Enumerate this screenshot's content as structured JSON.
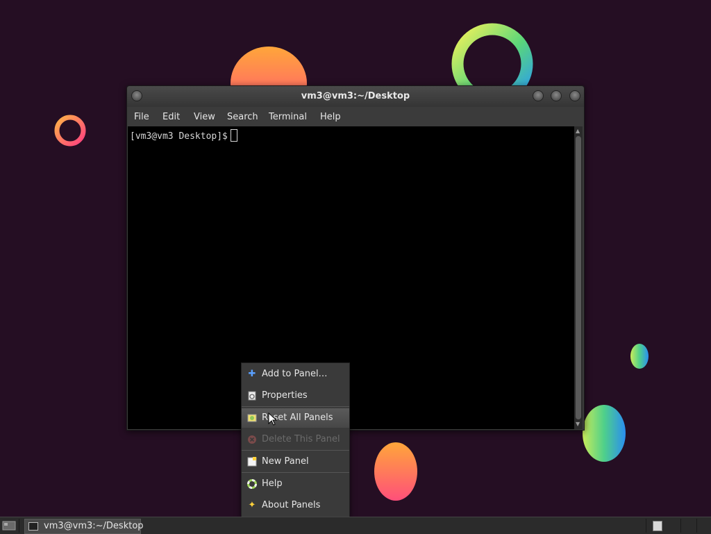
{
  "window": {
    "title": "vm3@vm3:~/Desktop",
    "menu": [
      "File",
      "Edit",
      "View",
      "Search",
      "Terminal",
      "Help"
    ],
    "prompt": "[vm3@vm3 Desktop]$"
  },
  "context_menu": {
    "items": [
      {
        "label": "Add to Panel…",
        "icon": "plus-icon",
        "state": "normal"
      },
      {
        "label": "Properties",
        "icon": "properties-icon",
        "state": "normal"
      },
      {
        "label": "Reset All Panels",
        "icon": "reset-panels-icon",
        "state": "hover"
      },
      {
        "label": "Delete This Panel",
        "icon": "delete-icon",
        "state": "disabled"
      },
      {
        "label": "New Panel",
        "icon": "new-panel-icon",
        "state": "normal"
      },
      {
        "label": "Help",
        "icon": "help-lifebuoy-icon",
        "state": "normal"
      },
      {
        "label": "About Panels",
        "icon": "star-icon",
        "state": "normal"
      }
    ]
  },
  "taskbar": {
    "task_label": "vm3@vm3:~/Desktop"
  },
  "colors": {
    "desktop_bg": "#250e23",
    "window_chrome": "#3b3b3b",
    "terminal_bg": "#000000",
    "menu_bg": "#3a3a3a"
  }
}
